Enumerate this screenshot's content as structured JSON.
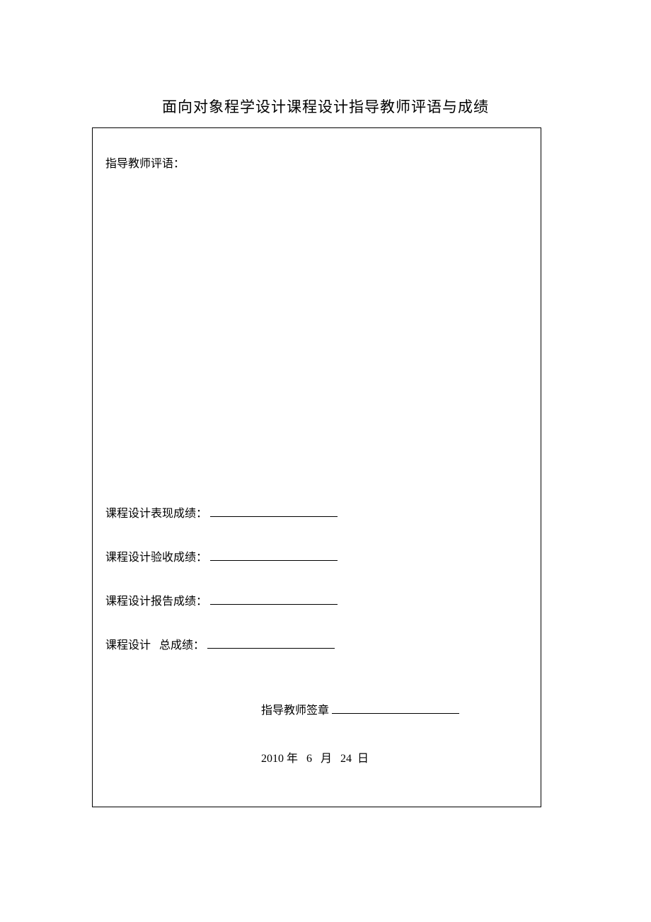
{
  "title": "面向对象程学设计课程设计指导教师评语与成绩",
  "form": {
    "comment_label": "指导教师评语：",
    "score_performance_label": "课程设计表现成绩：",
    "score_acceptance_label": "课程设计验收成绩：",
    "score_report_label": "课程设计报告成绩：",
    "score_total_label": "课程设计   总成绩：",
    "signature_label": "指导教师签章",
    "date_text": "2010 年   6   月   24  日"
  }
}
